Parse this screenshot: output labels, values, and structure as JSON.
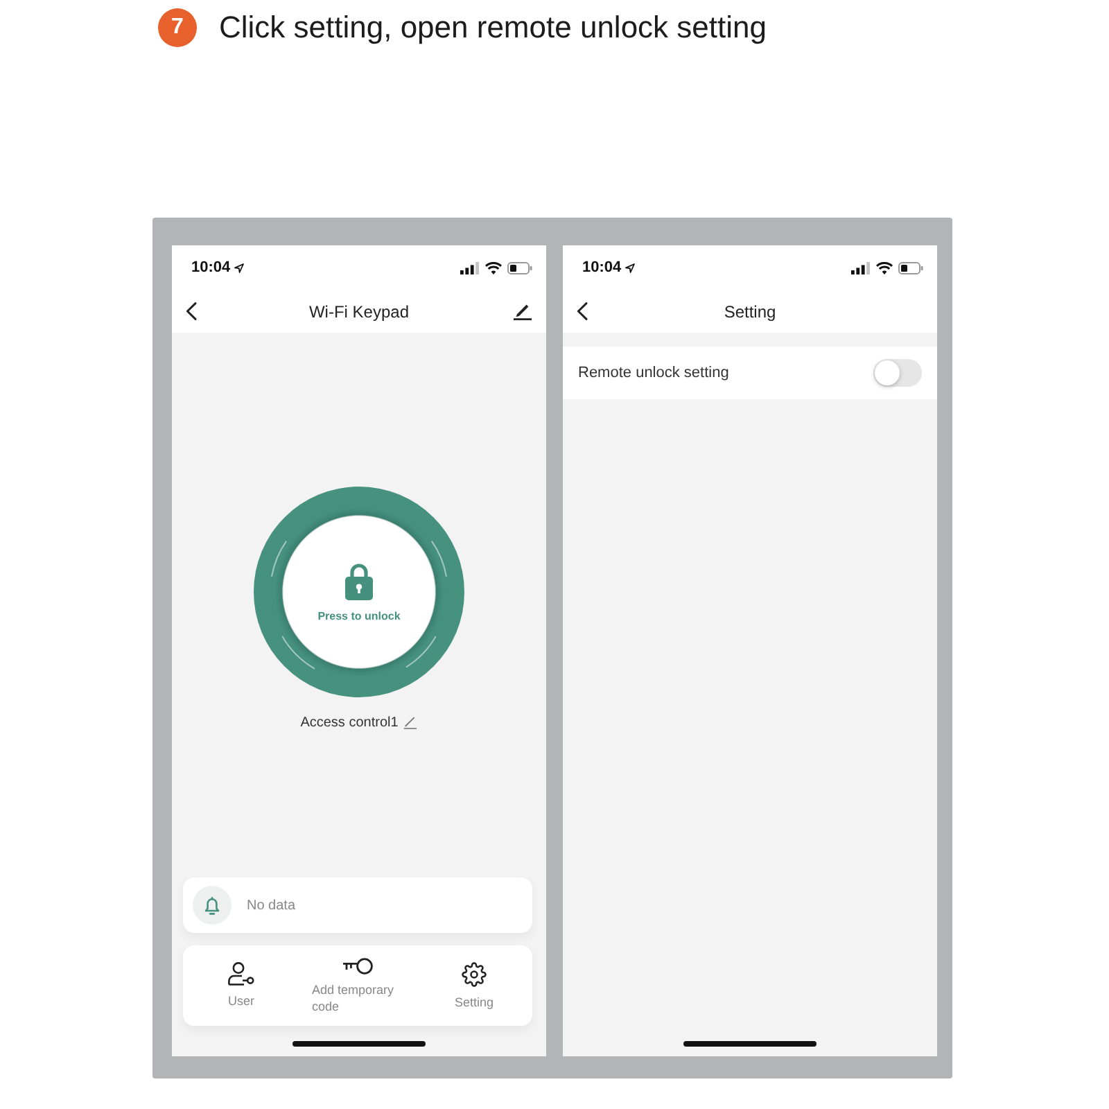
{
  "step": {
    "number": "7",
    "text": "Click setting, open remote unlock setting"
  },
  "keypad_screen": {
    "status_bar": {
      "time": "10:04"
    },
    "title": "Wi-Fi Keypad",
    "unlock_button": {
      "label": "Press to unlock"
    },
    "device_name": "Access control1",
    "notification": {
      "text": "No data"
    },
    "actions": [
      {
        "label": "User"
      },
      {
        "label": "Add temporary code"
      },
      {
        "label": "Setting"
      }
    ]
  },
  "setting_screen": {
    "status_bar": {
      "time": "10:04"
    },
    "title": "Setting",
    "settings": [
      {
        "label": "Remote unlock setting",
        "on": false
      }
    ]
  }
}
